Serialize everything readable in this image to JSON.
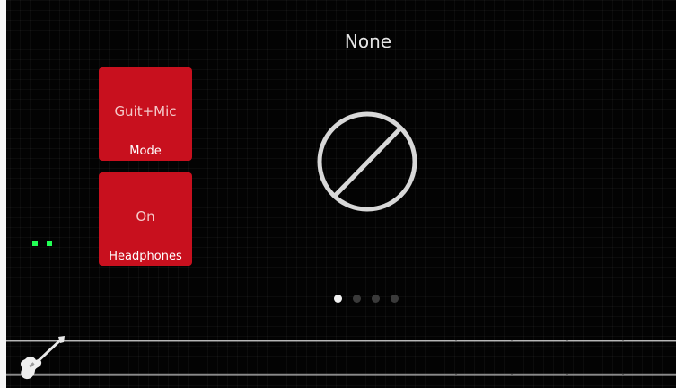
{
  "preset": {
    "name": "None",
    "symbol_icon": "none-circle-slash-icon"
  },
  "tiles": [
    {
      "value": "Guit+Mic",
      "label": "Mode"
    },
    {
      "value": "On",
      "label": "Headphones"
    }
  ],
  "pager": {
    "page_count": 4,
    "current_page": 1
  },
  "status": {
    "indicator_color": "#22ff55"
  },
  "footer": {
    "icon": "guitar-icon"
  },
  "colors": {
    "tile_background": "#c8101e",
    "background": "#030303",
    "accent_text": "#ffffff"
  }
}
